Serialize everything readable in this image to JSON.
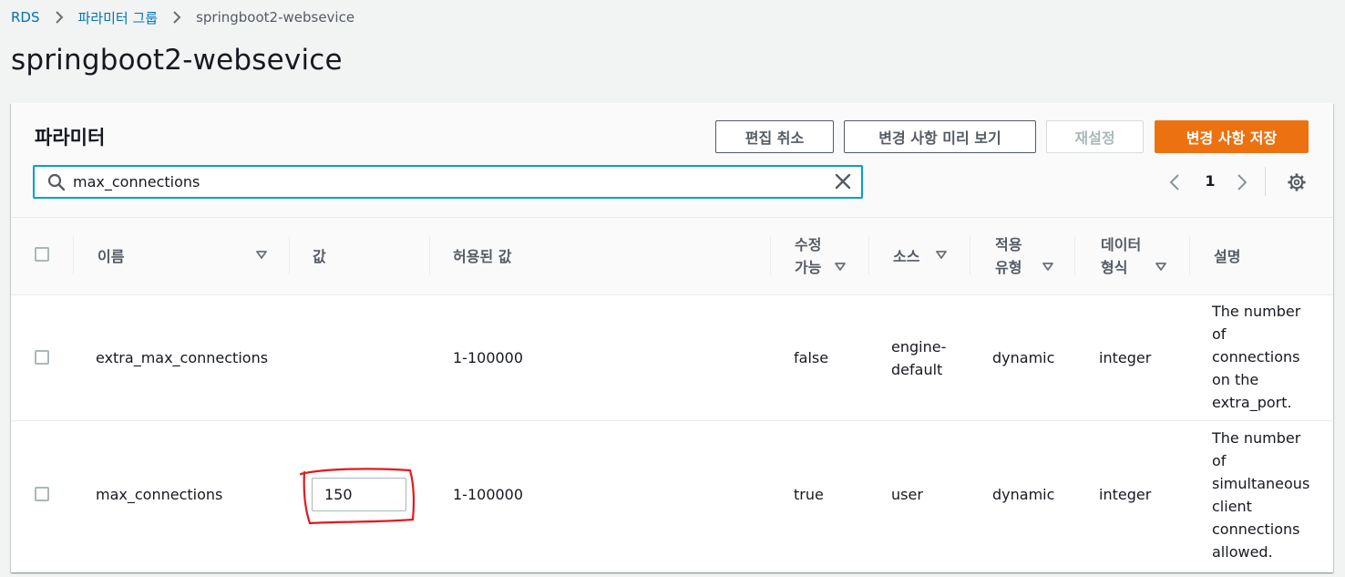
{
  "breadcrumb": {
    "root": "RDS",
    "parent": "파라미터 그룹",
    "current": "springboot2-websevice"
  },
  "page_title": "springboot2-websevice",
  "panel": {
    "title": "파라미터",
    "buttons": {
      "cancel_edit": "편집 취소",
      "preview_changes": "변경 사항 미리 보기",
      "reset": "재설정",
      "save_changes": "변경 사항 저장"
    },
    "search": {
      "value": "max_connections",
      "placeholder": ""
    },
    "pagination": {
      "current_page": "1"
    }
  },
  "table": {
    "headers": {
      "name": "이름",
      "value": "값",
      "allowed": "허용된 값",
      "modifiable_1": "수정",
      "modifiable_2": "가능",
      "source": "소스",
      "apply_type_1": "적용",
      "apply_type_2": "유형",
      "data_type_1": "데이터",
      "data_type_2": "형식",
      "description": "설명"
    },
    "rows": [
      {
        "name": "extra_max_connections",
        "value": "",
        "allowed": "1-100000",
        "modifiable": "false",
        "source_1": "engine-",
        "source_2": "default",
        "apply_type": "dynamic",
        "data_type": "integer",
        "description_lines": [
          "The number",
          "of",
          "connections",
          "on the",
          "extra_port."
        ]
      },
      {
        "name": "max_connections",
        "value": "150",
        "allowed": "1-100000",
        "modifiable": "true",
        "source_1": "user",
        "source_2": "",
        "apply_type": "dynamic",
        "data_type": "integer",
        "description_lines": [
          "The number",
          "of",
          "simultaneous",
          "client",
          "connections",
          "allowed."
        ]
      }
    ]
  },
  "colors": {
    "accent": "#0073bb",
    "primary_button": "#ec7211",
    "focus": "#00a1c9",
    "annotation": "#e8161b"
  },
  "icons": [
    "chevron-right-icon",
    "search-icon",
    "close-icon",
    "chevron-left-icon",
    "gear-icon",
    "sort-caret-down-icon"
  ]
}
